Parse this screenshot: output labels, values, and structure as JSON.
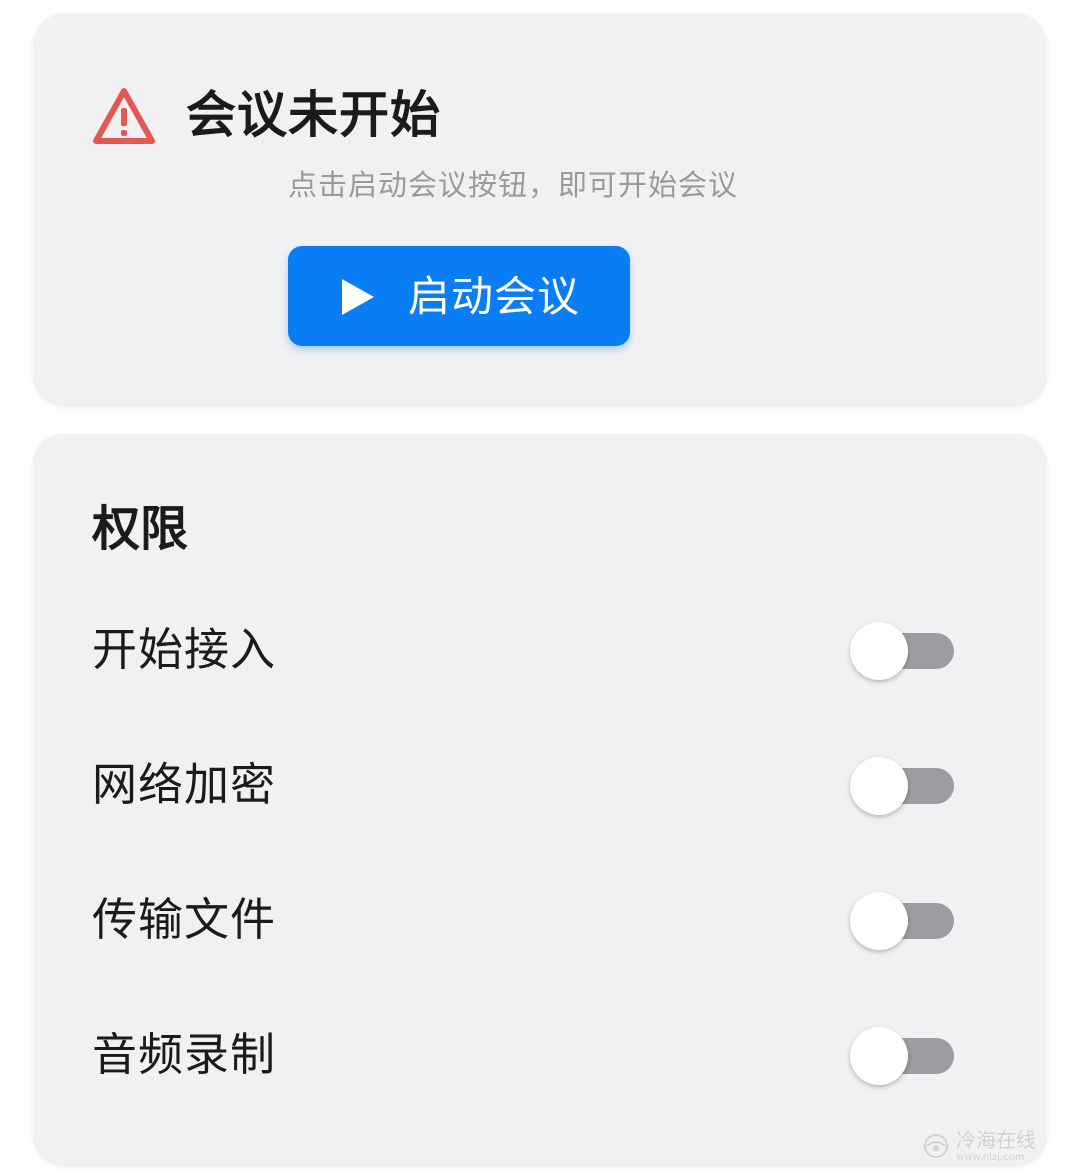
{
  "meeting_status": {
    "icon": "warning-icon",
    "title": "会议未开始",
    "hint": "点击启动会议按钮，即可开始会议",
    "start_button": {
      "icon": "play-icon",
      "label": "启动会议",
      "color": "#0a7cf4"
    }
  },
  "permissions": {
    "title": "权限",
    "items": [
      {
        "label": "开始接入",
        "enabled": false
      },
      {
        "label": "网络加密",
        "enabled": false
      },
      {
        "label": "传输文件",
        "enabled": false
      },
      {
        "label": "音频录制",
        "enabled": false
      }
    ]
  },
  "watermark": {
    "text": "冷海在线",
    "url": "www.nlzj.com"
  },
  "colors": {
    "card_background": "#f1f1f3",
    "warning": "#e05a52",
    "toggle_off_track": "#9d9da1"
  }
}
